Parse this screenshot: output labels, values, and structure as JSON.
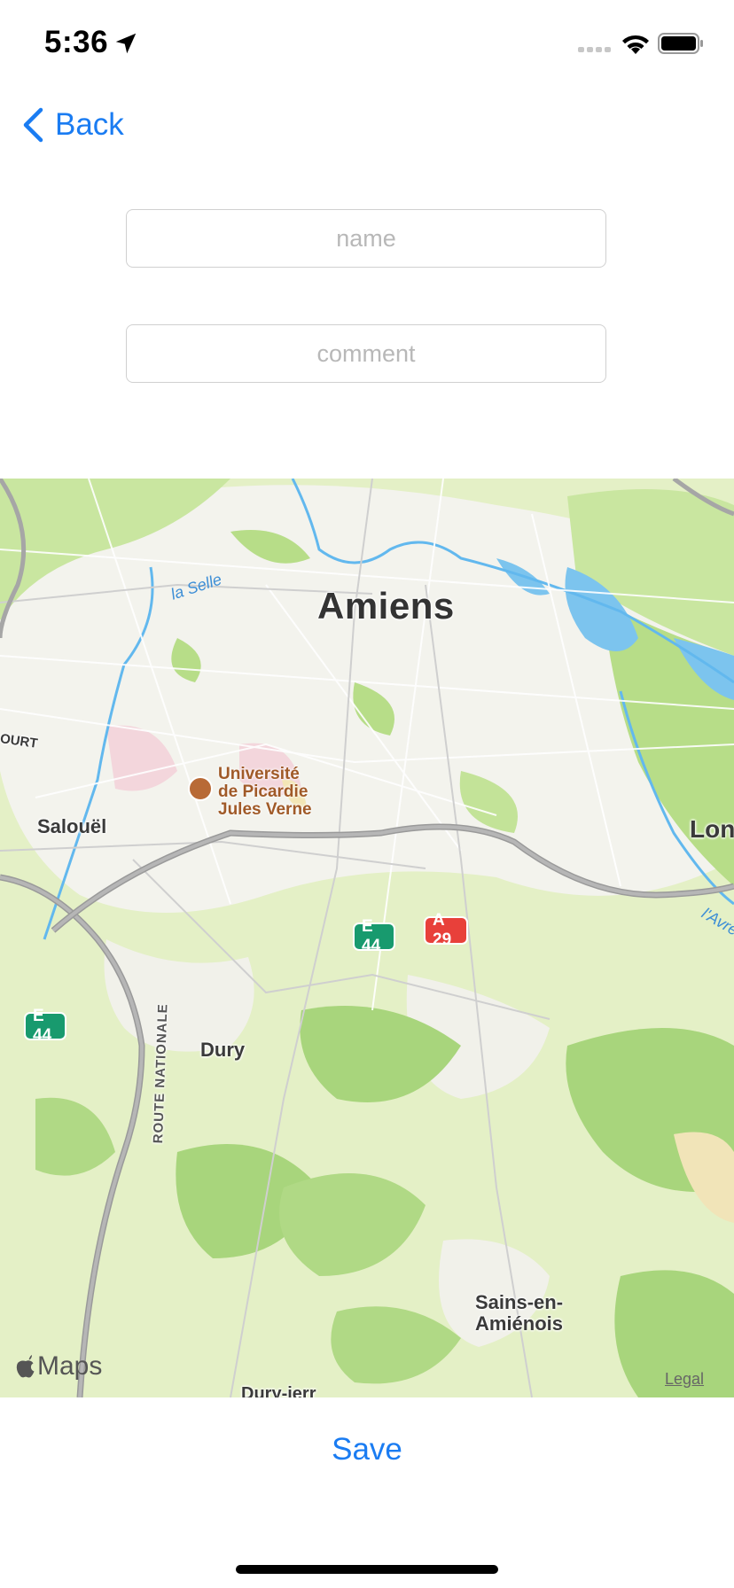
{
  "status_bar": {
    "time": "5:36",
    "icons": [
      "location-arrow-icon",
      "cellular-signal-icon",
      "wifi-icon",
      "battery-icon"
    ]
  },
  "nav": {
    "back_label": "Back",
    "accent_color": "#1a7cf2"
  },
  "form": {
    "name": {
      "value": "",
      "placeholder": "name"
    },
    "comment": {
      "value": "",
      "placeholder": "comment"
    }
  },
  "map": {
    "city_label": "Amiens",
    "places": {
      "salouel": "Salouël",
      "dury": "Dury",
      "sains_line1": "Sains-en-",
      "sains_line2": "Amiénois",
      "lon": "Lon",
      "ourt": "OURT",
      "bottom": "Dury-ierr"
    },
    "rivers": {
      "selle": "la Selle",
      "avre": "l'Avre"
    },
    "poi": {
      "line1": "Université",
      "line2": "de Picardie",
      "line3": "Jules Verne"
    },
    "route_label": "ROUTE NATIONALE",
    "shields": {
      "e44": "E 44",
      "a29": "A 29"
    },
    "attribution": "Maps",
    "legal": "Legal"
  },
  "actions": {
    "save_label": "Save"
  }
}
